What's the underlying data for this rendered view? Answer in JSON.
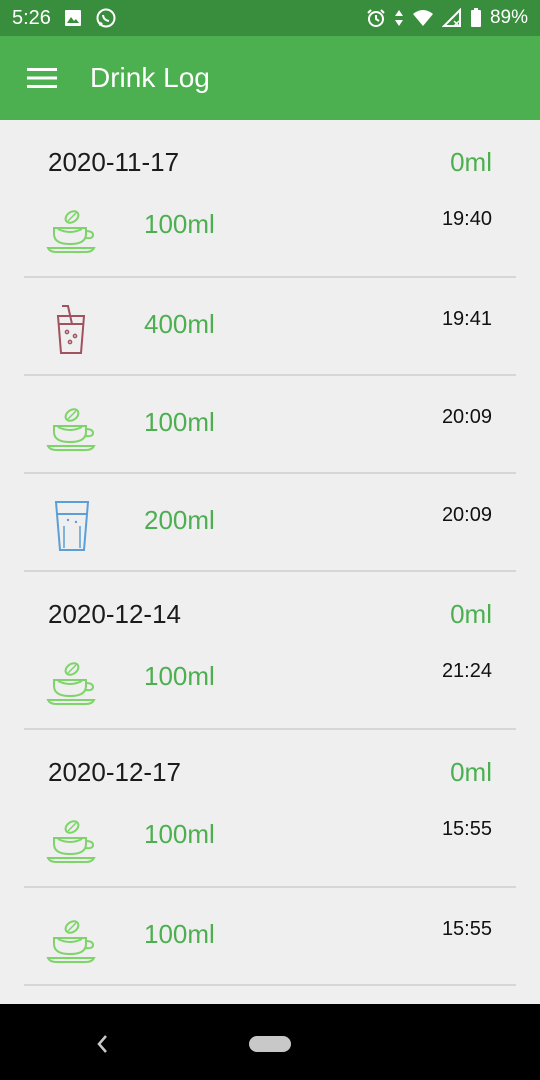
{
  "status": {
    "time": "5:26",
    "battery": "89%",
    "icons": [
      "image-icon",
      "whatsapp-icon",
      "alarm-icon",
      "data-arrows-icon",
      "wifi-icon",
      "signal-icon",
      "battery-icon"
    ]
  },
  "app_bar": {
    "title": "Drink Log",
    "menu_icon": "menu-icon"
  },
  "colors": {
    "accent": "#4caf50",
    "status": "#388e3c",
    "background": "#efefef"
  },
  "groups": [
    {
      "date": "2020-11-17",
      "total": "0ml",
      "entries": [
        {
          "icon": "tea-cup-icon",
          "amount": "100ml",
          "time": "19:40"
        },
        {
          "icon": "soda-glass-icon",
          "amount": "400ml",
          "time": "19:41"
        },
        {
          "icon": "tea-cup-icon",
          "amount": "100ml",
          "time": "20:09"
        },
        {
          "icon": "water-glass-icon",
          "amount": "200ml",
          "time": "20:09"
        }
      ]
    },
    {
      "date": "2020-12-14",
      "total": "0ml",
      "entries": [
        {
          "icon": "tea-cup-icon",
          "amount": "100ml",
          "time": "21:24"
        }
      ]
    },
    {
      "date": "2020-12-17",
      "total": "0ml",
      "entries": [
        {
          "icon": "tea-cup-icon",
          "amount": "100ml",
          "time": "15:55"
        },
        {
          "icon": "tea-cup-icon",
          "amount": "100ml",
          "time": "15:55"
        }
      ]
    }
  ]
}
